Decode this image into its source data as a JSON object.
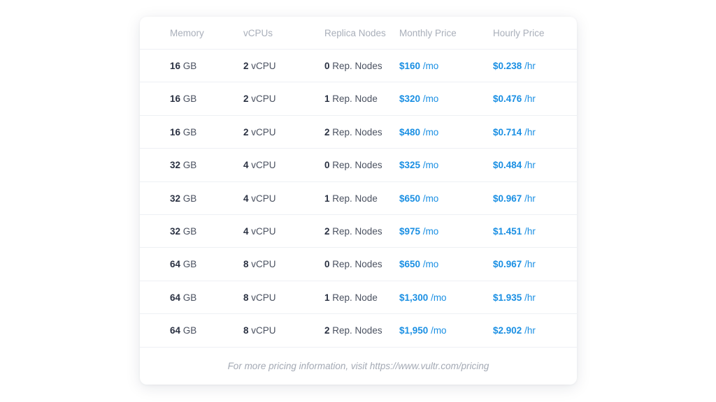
{
  "header": {
    "memory": "Memory",
    "vcpus": "vCPUs",
    "replica_nodes": "Replica Nodes",
    "monthly_price": "Monthly Price",
    "hourly_price": "Hourly Price"
  },
  "colors": {
    "accent": "#1a8fe3",
    "header_text": "#a9afba",
    "body_text": "#2a3142"
  },
  "rows": [
    {
      "mem": "16",
      "mem_unit": "GB",
      "cpu": "2",
      "cpu_unit": "vCPU",
      "rep": "0",
      "rep_unit": "Rep. Nodes",
      "mon": "$160",
      "mon_unit": "/mo",
      "hr": "$0.238",
      "hr_unit": "/hr"
    },
    {
      "mem": "16",
      "mem_unit": "GB",
      "cpu": "2",
      "cpu_unit": "vCPU",
      "rep": "1",
      "rep_unit": "Rep. Node",
      "mon": "$320",
      "mon_unit": "/mo",
      "hr": "$0.476",
      "hr_unit": "/hr"
    },
    {
      "mem": "16",
      "mem_unit": "GB",
      "cpu": "2",
      "cpu_unit": "vCPU",
      "rep": "2",
      "rep_unit": "Rep. Nodes",
      "mon": "$480",
      "mon_unit": "/mo",
      "hr": "$0.714",
      "hr_unit": "/hr"
    },
    {
      "mem": "32",
      "mem_unit": "GB",
      "cpu": "4",
      "cpu_unit": "vCPU",
      "rep": "0",
      "rep_unit": "Rep. Nodes",
      "mon": "$325",
      "mon_unit": "/mo",
      "hr": "$0.484",
      "hr_unit": "/hr"
    },
    {
      "mem": "32",
      "mem_unit": "GB",
      "cpu": "4",
      "cpu_unit": "vCPU",
      "rep": "1",
      "rep_unit": "Rep. Node",
      "mon": "$650",
      "mon_unit": "/mo",
      "hr": "$0.967",
      "hr_unit": "/hr"
    },
    {
      "mem": "32",
      "mem_unit": "GB",
      "cpu": "4",
      "cpu_unit": "vCPU",
      "rep": "2",
      "rep_unit": "Rep. Nodes",
      "mon": "$975",
      "mon_unit": "/mo",
      "hr": "$1.451",
      "hr_unit": "/hr"
    },
    {
      "mem": "64",
      "mem_unit": "GB",
      "cpu": "8",
      "cpu_unit": "vCPU",
      "rep": "0",
      "rep_unit": "Rep. Nodes",
      "mon": "$650",
      "mon_unit": "/mo",
      "hr": "$0.967",
      "hr_unit": "/hr"
    },
    {
      "mem": "64",
      "mem_unit": "GB",
      "cpu": "8",
      "cpu_unit": "vCPU",
      "rep": "1",
      "rep_unit": "Rep. Node",
      "mon": "$1,300",
      "mon_unit": "/mo",
      "hr": "$1.935",
      "hr_unit": "/hr"
    },
    {
      "mem": "64",
      "mem_unit": "GB",
      "cpu": "8",
      "cpu_unit": "vCPU",
      "rep": "2",
      "rep_unit": "Rep. Nodes",
      "mon": "$1,950",
      "mon_unit": "/mo",
      "hr": "$2.902",
      "hr_unit": "/hr"
    }
  ],
  "footer": {
    "text": "For more pricing information, visit https://www.vultr.com/pricing"
  }
}
